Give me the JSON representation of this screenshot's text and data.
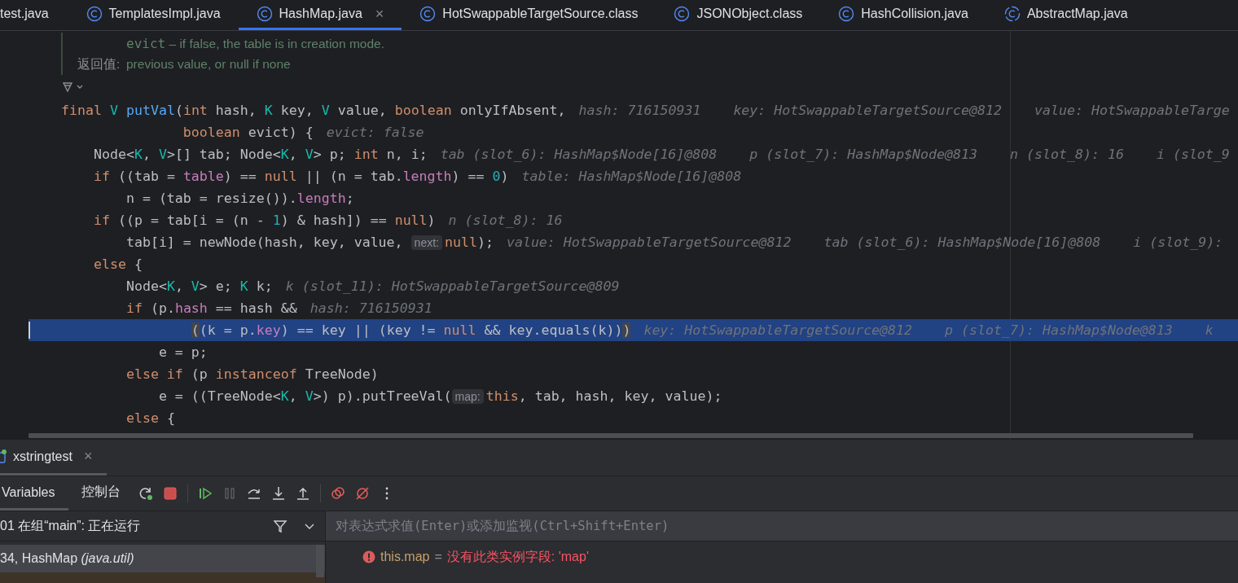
{
  "editor_tabs": [
    {
      "label": "test.java",
      "kind": "file",
      "selected": false
    },
    {
      "label": "TemplatesImpl.java",
      "kind": "class",
      "selected": false
    },
    {
      "label": "HashMap.java",
      "kind": "class",
      "selected": true,
      "close": "×"
    },
    {
      "label": "HotSwappableTargetSource.class",
      "kind": "class",
      "selected": false
    },
    {
      "label": "JSONObject.class",
      "kind": "class",
      "selected": false
    },
    {
      "label": "HashCollision.java",
      "kind": "class",
      "selected": false
    },
    {
      "label": "AbstractMap.java",
      "kind": "abstract",
      "selected": false
    }
  ],
  "doc": [
    {
      "code": "evict",
      "text": " – if false, the table is in creation mode."
    },
    {
      "label": "返回值:",
      "text": "previous value, or null if none"
    }
  ],
  "code_lines": [
    {
      "current": false,
      "tokens": [
        {
          "kind": "kw",
          "text": "final "
        },
        {
          "kind": "tp",
          "text": "V "
        },
        {
          "kind": "fn",
          "text": "putVal"
        },
        {
          "kind": "txt",
          "text": "("
        },
        {
          "kind": "kw",
          "text": "int "
        },
        {
          "kind": "txt",
          "text": "hash, "
        },
        {
          "kind": "tp",
          "text": "K"
        },
        {
          "kind": "txt",
          "text": " key, "
        },
        {
          "kind": "tp",
          "text": "V"
        },
        {
          "kind": "txt",
          "text": " value, "
        },
        {
          "kind": "kw",
          "text": "boolean "
        },
        {
          "kind": "txt",
          "text": "onlyIfAbsent,"
        }
      ],
      "hints": [
        "hash: 716150931",
        "key: HotSwappableTargetSource@812",
        "value: HotSwappableTarge"
      ]
    },
    {
      "current": false,
      "tokens": [
        {
          "kind": "kw",
          "text": "               boolean "
        },
        {
          "kind": "txt",
          "text": "evict) {"
        }
      ],
      "hints": [
        "evict: false"
      ]
    },
    {
      "current": false,
      "tokens": [
        {
          "kind": "txt",
          "text": "    Node<"
        },
        {
          "kind": "tp",
          "text": "K"
        },
        {
          "kind": "txt",
          "text": ", "
        },
        {
          "kind": "tp",
          "text": "V"
        },
        {
          "kind": "txt",
          "text": ">[] tab; Node<"
        },
        {
          "kind": "tp",
          "text": "K"
        },
        {
          "kind": "txt",
          "text": ", "
        },
        {
          "kind": "tp",
          "text": "V"
        },
        {
          "kind": "txt",
          "text": "> p; "
        },
        {
          "kind": "kw",
          "text": "int "
        },
        {
          "kind": "txt",
          "text": "n, i;"
        }
      ],
      "hints": [
        "tab (slot_6): HashMap$Node[16]@808",
        "p (slot_7): HashMap$Node@813",
        "n (slot_8): 16",
        "i (slot_9"
      ]
    },
    {
      "current": false,
      "tokens": [
        {
          "kind": "kw",
          "text": "    if "
        },
        {
          "kind": "txt",
          "text": "((tab = "
        },
        {
          "kind": "fld",
          "text": "table"
        },
        {
          "kind": "txt",
          "text": ") == "
        },
        {
          "kind": "kw",
          "text": "null"
        },
        {
          "kind": "txt",
          "text": " || (n = tab."
        },
        {
          "kind": "fld",
          "text": "length"
        },
        {
          "kind": "txt",
          "text": ") == "
        },
        {
          "kind": "num",
          "text": "0"
        },
        {
          "kind": "txt",
          "text": ")"
        }
      ],
      "hints": [
        "table: HashMap$Node[16]@808"
      ]
    },
    {
      "current": false,
      "tokens": [
        {
          "kind": "txt",
          "text": "        n = (tab = resize())."
        },
        {
          "kind": "fld",
          "text": "length"
        },
        {
          "kind": "txt",
          "text": ";"
        }
      ]
    },
    {
      "current": false,
      "tokens": [
        {
          "kind": "kw",
          "text": "    if "
        },
        {
          "kind": "txt",
          "text": "((p = tab[i = (n - "
        },
        {
          "kind": "num",
          "text": "1"
        },
        {
          "kind": "txt",
          "text": ") & hash]) == "
        },
        {
          "kind": "kw",
          "text": "null"
        },
        {
          "kind": "txt",
          "text": ")"
        }
      ],
      "hints": [
        "n (slot_8): 16"
      ]
    },
    {
      "current": false,
      "tokens": [
        {
          "kind": "txt",
          "text": "        tab[i] = newNode(hash, key, value, "
        },
        {
          "kind": "inlay",
          "text": "next:"
        },
        {
          "kind": "kw",
          "text": "null"
        },
        {
          "kind": "txt",
          "text": ");"
        }
      ],
      "hints": [
        "value: HotSwappableTargetSource@812",
        "tab (slot_6): HashMap$Node[16]@808",
        "i (slot_9):"
      ]
    },
    {
      "current": false,
      "tokens": [
        {
          "kind": "kw",
          "text": "    else "
        },
        {
          "kind": "txt",
          "text": "{"
        }
      ]
    },
    {
      "current": false,
      "tokens": [
        {
          "kind": "txt",
          "text": "        Node<"
        },
        {
          "kind": "tp",
          "text": "K"
        },
        {
          "kind": "txt",
          "text": ", "
        },
        {
          "kind": "tp",
          "text": "V"
        },
        {
          "kind": "txt",
          "text": "> e; "
        },
        {
          "kind": "tp",
          "text": "K"
        },
        {
          "kind": "txt",
          "text": " k;"
        }
      ],
      "hints": [
        "k (slot_11): HotSwappableTargetSource@809"
      ]
    },
    {
      "current": false,
      "tokens": [
        {
          "kind": "kw",
          "text": "        if "
        },
        {
          "kind": "txt",
          "text": "(p."
        },
        {
          "kind": "fld",
          "text": "hash"
        },
        {
          "kind": "txt",
          "text": " == hash &&"
        }
      ],
      "hints": [
        "hash: 716150931"
      ]
    },
    {
      "current": true,
      "tokens": [
        {
          "kind": "brace",
          "text": "                ("
        },
        {
          "kind": "txt",
          "text": "(k = p."
        },
        {
          "kind": "fld",
          "text": "key"
        },
        {
          "kind": "txt",
          "text": ") == key || (key != "
        },
        {
          "kind": "kw",
          "text": "null"
        },
        {
          "kind": "txt",
          "text": " && key.equals(k))"
        },
        {
          "kind": "brace",
          "text": ")"
        }
      ],
      "hints": [
        "key: HotSwappableTargetSource@812",
        "p (slot_7): HashMap$Node@813",
        "k"
      ]
    },
    {
      "current": false,
      "tokens": [
        {
          "kind": "txt",
          "text": "            e = p;"
        }
      ]
    },
    {
      "current": false,
      "tokens": [
        {
          "kind": "kw",
          "text": "        else if "
        },
        {
          "kind": "txt",
          "text": "(p "
        },
        {
          "kind": "kw",
          "text": "instanceof "
        },
        {
          "kind": "txt",
          "text": "TreeNode)"
        }
      ]
    },
    {
      "current": false,
      "tokens": [
        {
          "kind": "txt",
          "text": "            e = ((TreeNode<"
        },
        {
          "kind": "tp",
          "text": "K"
        },
        {
          "kind": "txt",
          "text": ", "
        },
        {
          "kind": "tp",
          "text": "V"
        },
        {
          "kind": "txt",
          "text": ">) p).putTreeVal("
        },
        {
          "kind": "inlay",
          "text": "map:"
        },
        {
          "kind": "kw",
          "text": "this"
        },
        {
          "kind": "txt",
          "text": ", tab, hash, key, value);"
        }
      ]
    },
    {
      "current": false,
      "tokens": [
        {
          "kind": "kw",
          "text": "        else "
        },
        {
          "kind": "txt",
          "text": "{"
        }
      ]
    }
  ],
  "debug": {
    "session_tab": {
      "label": "xstringtest",
      "selected": true,
      "close": "×"
    },
    "tabs": [
      {
        "label": "Variables",
        "selected": true
      },
      {
        "label": "控制台",
        "selected": false
      }
    ],
    "thread": "01 在组“main”: 正在运行",
    "frames": [
      {
        "label": "34, HashMap *(java.util)*",
        "selected": true
      }
    ],
    "evaluate": {
      "placeholder": "对表达式求值(Enter)或添加监视(Ctrl+Shift+Enter)"
    },
    "variables": [
      {
        "name": "this.map",
        "op": "=",
        "value": "没有此类实例字段: 'map'",
        "kind": "error"
      }
    ]
  }
}
